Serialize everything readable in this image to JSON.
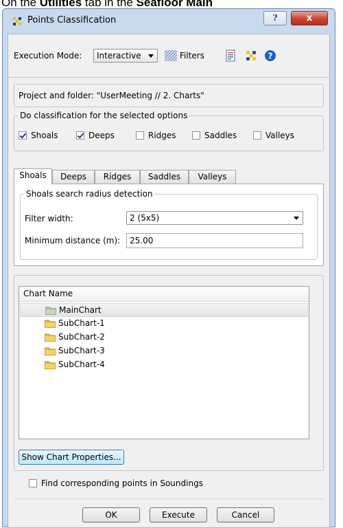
{
  "caption": {
    "prefix": "On the ",
    "bold1": "Utilities",
    "middle": " tab in the ",
    "bold2": "Seafloor Main"
  },
  "window": {
    "title": "Points Classification",
    "help_glyph": "?",
    "close_glyph": "x"
  },
  "toolbar": {
    "execution_label": "Execution Mode:",
    "execution_value": "Interactive",
    "filters_label": "Filters"
  },
  "project": {
    "text": "Project and folder: \"UserMeeting // 2. Charts\""
  },
  "options": {
    "title": "Do classification for the selected options",
    "items": [
      {
        "label": "Shoals",
        "checked": true
      },
      {
        "label": "Deeps",
        "checked": true
      },
      {
        "label": "Ridges",
        "checked": false
      },
      {
        "label": "Saddles",
        "checked": false
      },
      {
        "label": "Valleys",
        "checked": false
      }
    ]
  },
  "tabs": [
    "Shoals",
    "Deeps",
    "Ridges",
    "Saddles",
    "Valleys"
  ],
  "active_tab": "Shoals",
  "radius": {
    "title": "Shoals search radius detection",
    "filter_label": "Filter width:",
    "filter_value": "2 (5x5)",
    "min_label": "Minimum distance (m):",
    "min_value": "25.00"
  },
  "charts": {
    "header": "Chart Name",
    "items": [
      "MainChart",
      "SubChart-1",
      "SubChart-2",
      "SubChart-3",
      "SubChart-4"
    ],
    "selected": "MainChart",
    "properties_button": "Show Chart Properties..."
  },
  "soundings": {
    "label": "Find corresponding points in Soundings",
    "checked": false
  },
  "buttons": {
    "ok": "OK",
    "execute": "Execute",
    "cancel": "Cancel"
  },
  "colors": {
    "window_frame": "#c9d9ee",
    "close_button": "#c8432f",
    "help_icon": "#1c5fcb"
  }
}
